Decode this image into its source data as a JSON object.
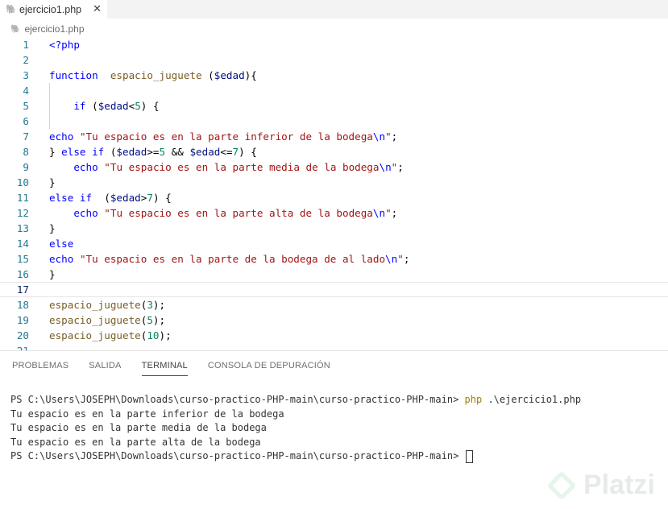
{
  "tab": {
    "label": "ejercicio1.php",
    "close": "✕",
    "icon": "php-elephant-icon"
  },
  "breadcrumb": {
    "label": "ejercicio1.php"
  },
  "editor": {
    "lines": [
      {
        "n": "1",
        "t": [
          [
            "kw",
            "<?php"
          ]
        ]
      },
      {
        "n": "2",
        "t": []
      },
      {
        "n": "3",
        "t": [
          [
            "kw",
            "function"
          ],
          [
            "",
            "  "
          ],
          [
            "fn",
            "espacio_juguete"
          ],
          [
            "",
            " ("
          ],
          [
            "var",
            "$edad"
          ],
          [
            "",
            "){"
          ]
        ]
      },
      {
        "n": "4",
        "t": []
      },
      {
        "n": "5",
        "t": [
          [
            "",
            "    "
          ],
          [
            "kw",
            "if"
          ],
          [
            "",
            " ("
          ],
          [
            "var",
            "$edad"
          ],
          [
            "",
            "<"
          ],
          [
            "num",
            "5"
          ],
          [
            "",
            ") {"
          ]
        ]
      },
      {
        "n": "6",
        "t": []
      },
      {
        "n": "7",
        "t": [
          [
            "kw",
            "echo"
          ],
          [
            "",
            " "
          ],
          [
            "str",
            "\"Tu espacio es en la parte inferior de la bodega"
          ],
          [
            "cc",
            "\\n"
          ],
          [
            "str",
            "\""
          ],
          [
            "",
            ";"
          ]
        ]
      },
      {
        "n": "8",
        "t": [
          [
            "",
            "} "
          ],
          [
            "kw",
            "else if"
          ],
          [
            "",
            " ("
          ],
          [
            "var",
            "$edad"
          ],
          [
            "",
            ">="
          ],
          [
            "num",
            "5"
          ],
          [
            "",
            " && "
          ],
          [
            "var",
            "$edad"
          ],
          [
            "",
            "<="
          ],
          [
            "num",
            "7"
          ],
          [
            "",
            ") {"
          ]
        ]
      },
      {
        "n": "9",
        "t": [
          [
            "",
            "    "
          ],
          [
            "kw",
            "echo"
          ],
          [
            "",
            " "
          ],
          [
            "str",
            "\"Tu espacio es en la parte media de la bodega"
          ],
          [
            "cc",
            "\\n"
          ],
          [
            "str",
            "\""
          ],
          [
            "",
            ";"
          ]
        ]
      },
      {
        "n": "10",
        "t": [
          [
            "",
            "}"
          ]
        ]
      },
      {
        "n": "11",
        "t": [
          [
            "kw",
            "else if"
          ],
          [
            "",
            "  ("
          ],
          [
            "var",
            "$edad"
          ],
          [
            "",
            ">"
          ],
          [
            "num",
            "7"
          ],
          [
            "",
            ") {"
          ]
        ]
      },
      {
        "n": "12",
        "t": [
          [
            "",
            "    "
          ],
          [
            "kw",
            "echo"
          ],
          [
            "",
            " "
          ],
          [
            "str",
            "\"Tu espacio es en la parte alta de la bodega"
          ],
          [
            "cc",
            "\\n"
          ],
          [
            "str",
            "\""
          ],
          [
            "",
            ";"
          ]
        ]
      },
      {
        "n": "13",
        "t": [
          [
            "",
            "}"
          ]
        ]
      },
      {
        "n": "14",
        "t": [
          [
            "kw",
            "else"
          ]
        ]
      },
      {
        "n": "15",
        "t": [
          [
            "kw",
            "echo"
          ],
          [
            "",
            " "
          ],
          [
            "str",
            "\"Tu espacio es en la parte de la bodega de al lado"
          ],
          [
            "cc",
            "\\n"
          ],
          [
            "str",
            "\""
          ],
          [
            "",
            ";"
          ]
        ]
      },
      {
        "n": "16",
        "t": [
          [
            "",
            "}"
          ]
        ]
      },
      {
        "n": "17",
        "t": []
      },
      {
        "n": "18",
        "t": [
          [
            "fn",
            "espacio_juguete"
          ],
          [
            "",
            "("
          ],
          [
            "num",
            "3"
          ],
          [
            "",
            ");"
          ]
        ]
      },
      {
        "n": "19",
        "t": [
          [
            "fn",
            "espacio_juguete"
          ],
          [
            "",
            "("
          ],
          [
            "num",
            "5"
          ],
          [
            "",
            ");"
          ]
        ]
      },
      {
        "n": "20",
        "t": [
          [
            "fn",
            "espacio_juguete"
          ],
          [
            "",
            "("
          ],
          [
            "num",
            "10"
          ],
          [
            "",
            ");"
          ]
        ]
      },
      {
        "n": "21",
        "t": []
      }
    ]
  },
  "panel": {
    "tabs": [
      "PROBLEMAS",
      "SALIDA",
      "TERMINAL",
      "CONSOLA DE DEPURACIÓN"
    ],
    "active_tab": "TERMINAL"
  },
  "terminal": {
    "prompt1": "PS C:\\Users\\JOSEPH\\Downloads\\curso-practico-PHP-main\\curso-practico-PHP-main> ",
    "cmd": "php",
    "arg": " .\\ejercicio1.php",
    "out1": "Tu espacio es en la parte inferior de la bodega",
    "out2": "Tu espacio es en la parte media de la bodega",
    "out3": "Tu espacio es en la parte alta de la bodega",
    "prompt2": "PS C:\\Users\\JOSEPH\\Downloads\\curso-practico-PHP-main\\curso-practico-PHP-main> "
  },
  "watermark": {
    "text": "Platzi"
  }
}
